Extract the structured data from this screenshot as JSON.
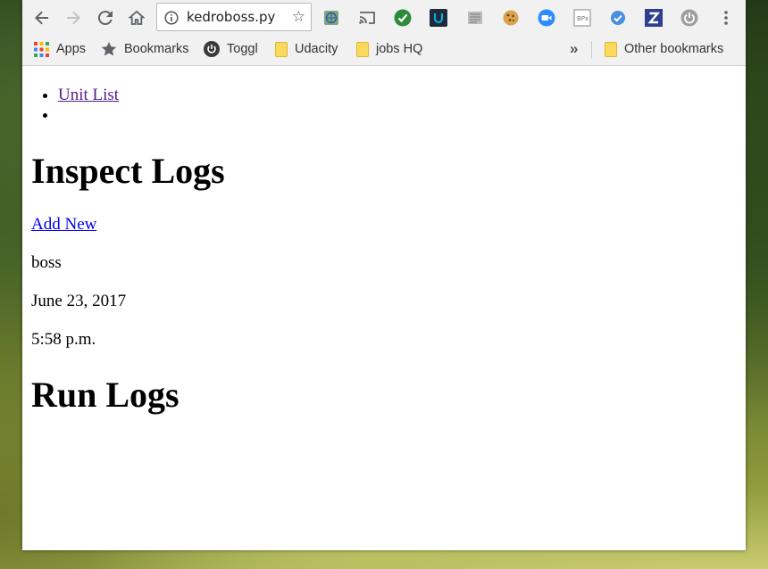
{
  "browser": {
    "url": "kedroboss.py",
    "bookmarks": [
      {
        "label": "Apps"
      },
      {
        "label": "Bookmarks"
      },
      {
        "label": "Toggl"
      },
      {
        "label": "Udacity"
      },
      {
        "label": "jobs HQ"
      }
    ],
    "overflow_label": "»",
    "other_bookmarks": "Other bookmarks"
  },
  "page": {
    "nav": [
      {
        "label": "Unit List"
      },
      {
        "label": ""
      }
    ],
    "title": "Inspect Logs",
    "add_new": "Add New",
    "user": "boss",
    "date": "June 23, 2017",
    "time": "5:58 p.m.",
    "section_title": "Run Logs"
  },
  "colors": {
    "link": "#0000ee",
    "link_visited": "#551a8b",
    "toolbar_bg": "#f1f1f1"
  }
}
